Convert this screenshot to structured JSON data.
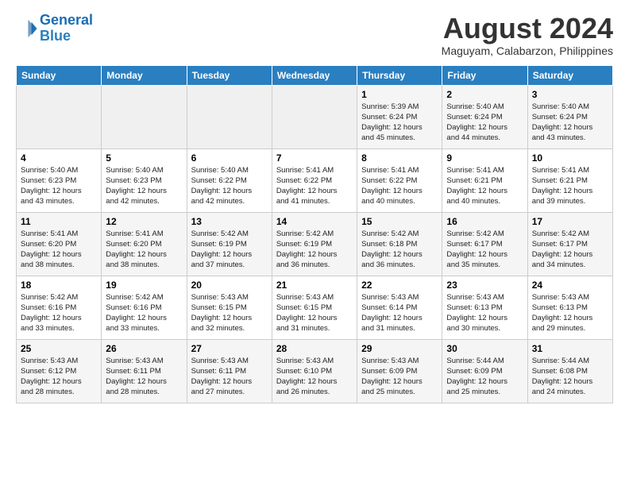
{
  "header": {
    "logo_line1": "General",
    "logo_line2": "Blue",
    "month_year": "August 2024",
    "location": "Maguyam, Calabarzon, Philippines"
  },
  "weekdays": [
    "Sunday",
    "Monday",
    "Tuesday",
    "Wednesday",
    "Thursday",
    "Friday",
    "Saturday"
  ],
  "weeks": [
    [
      {
        "day": "",
        "info": ""
      },
      {
        "day": "",
        "info": ""
      },
      {
        "day": "",
        "info": ""
      },
      {
        "day": "",
        "info": ""
      },
      {
        "day": "1",
        "info": "Sunrise: 5:39 AM\nSunset: 6:24 PM\nDaylight: 12 hours\nand 45 minutes."
      },
      {
        "day": "2",
        "info": "Sunrise: 5:40 AM\nSunset: 6:24 PM\nDaylight: 12 hours\nand 44 minutes."
      },
      {
        "day": "3",
        "info": "Sunrise: 5:40 AM\nSunset: 6:24 PM\nDaylight: 12 hours\nand 43 minutes."
      }
    ],
    [
      {
        "day": "4",
        "info": "Sunrise: 5:40 AM\nSunset: 6:23 PM\nDaylight: 12 hours\nand 43 minutes."
      },
      {
        "day": "5",
        "info": "Sunrise: 5:40 AM\nSunset: 6:23 PM\nDaylight: 12 hours\nand 42 minutes."
      },
      {
        "day": "6",
        "info": "Sunrise: 5:40 AM\nSunset: 6:22 PM\nDaylight: 12 hours\nand 42 minutes."
      },
      {
        "day": "7",
        "info": "Sunrise: 5:41 AM\nSunset: 6:22 PM\nDaylight: 12 hours\nand 41 minutes."
      },
      {
        "day": "8",
        "info": "Sunrise: 5:41 AM\nSunset: 6:22 PM\nDaylight: 12 hours\nand 40 minutes."
      },
      {
        "day": "9",
        "info": "Sunrise: 5:41 AM\nSunset: 6:21 PM\nDaylight: 12 hours\nand 40 minutes."
      },
      {
        "day": "10",
        "info": "Sunrise: 5:41 AM\nSunset: 6:21 PM\nDaylight: 12 hours\nand 39 minutes."
      }
    ],
    [
      {
        "day": "11",
        "info": "Sunrise: 5:41 AM\nSunset: 6:20 PM\nDaylight: 12 hours\nand 38 minutes."
      },
      {
        "day": "12",
        "info": "Sunrise: 5:41 AM\nSunset: 6:20 PM\nDaylight: 12 hours\nand 38 minutes."
      },
      {
        "day": "13",
        "info": "Sunrise: 5:42 AM\nSunset: 6:19 PM\nDaylight: 12 hours\nand 37 minutes."
      },
      {
        "day": "14",
        "info": "Sunrise: 5:42 AM\nSunset: 6:19 PM\nDaylight: 12 hours\nand 36 minutes."
      },
      {
        "day": "15",
        "info": "Sunrise: 5:42 AM\nSunset: 6:18 PM\nDaylight: 12 hours\nand 36 minutes."
      },
      {
        "day": "16",
        "info": "Sunrise: 5:42 AM\nSunset: 6:17 PM\nDaylight: 12 hours\nand 35 minutes."
      },
      {
        "day": "17",
        "info": "Sunrise: 5:42 AM\nSunset: 6:17 PM\nDaylight: 12 hours\nand 34 minutes."
      }
    ],
    [
      {
        "day": "18",
        "info": "Sunrise: 5:42 AM\nSunset: 6:16 PM\nDaylight: 12 hours\nand 33 minutes."
      },
      {
        "day": "19",
        "info": "Sunrise: 5:42 AM\nSunset: 6:16 PM\nDaylight: 12 hours\nand 33 minutes."
      },
      {
        "day": "20",
        "info": "Sunrise: 5:43 AM\nSunset: 6:15 PM\nDaylight: 12 hours\nand 32 minutes."
      },
      {
        "day": "21",
        "info": "Sunrise: 5:43 AM\nSunset: 6:15 PM\nDaylight: 12 hours\nand 31 minutes."
      },
      {
        "day": "22",
        "info": "Sunrise: 5:43 AM\nSunset: 6:14 PM\nDaylight: 12 hours\nand 31 minutes."
      },
      {
        "day": "23",
        "info": "Sunrise: 5:43 AM\nSunset: 6:13 PM\nDaylight: 12 hours\nand 30 minutes."
      },
      {
        "day": "24",
        "info": "Sunrise: 5:43 AM\nSunset: 6:13 PM\nDaylight: 12 hours\nand 29 minutes."
      }
    ],
    [
      {
        "day": "25",
        "info": "Sunrise: 5:43 AM\nSunset: 6:12 PM\nDaylight: 12 hours\nand 28 minutes."
      },
      {
        "day": "26",
        "info": "Sunrise: 5:43 AM\nSunset: 6:11 PM\nDaylight: 12 hours\nand 28 minutes."
      },
      {
        "day": "27",
        "info": "Sunrise: 5:43 AM\nSunset: 6:11 PM\nDaylight: 12 hours\nand 27 minutes."
      },
      {
        "day": "28",
        "info": "Sunrise: 5:43 AM\nSunset: 6:10 PM\nDaylight: 12 hours\nand 26 minutes."
      },
      {
        "day": "29",
        "info": "Sunrise: 5:43 AM\nSunset: 6:09 PM\nDaylight: 12 hours\nand 25 minutes."
      },
      {
        "day": "30",
        "info": "Sunrise: 5:44 AM\nSunset: 6:09 PM\nDaylight: 12 hours\nand 25 minutes."
      },
      {
        "day": "31",
        "info": "Sunrise: 5:44 AM\nSunset: 6:08 PM\nDaylight: 12 hours\nand 24 minutes."
      }
    ]
  ]
}
